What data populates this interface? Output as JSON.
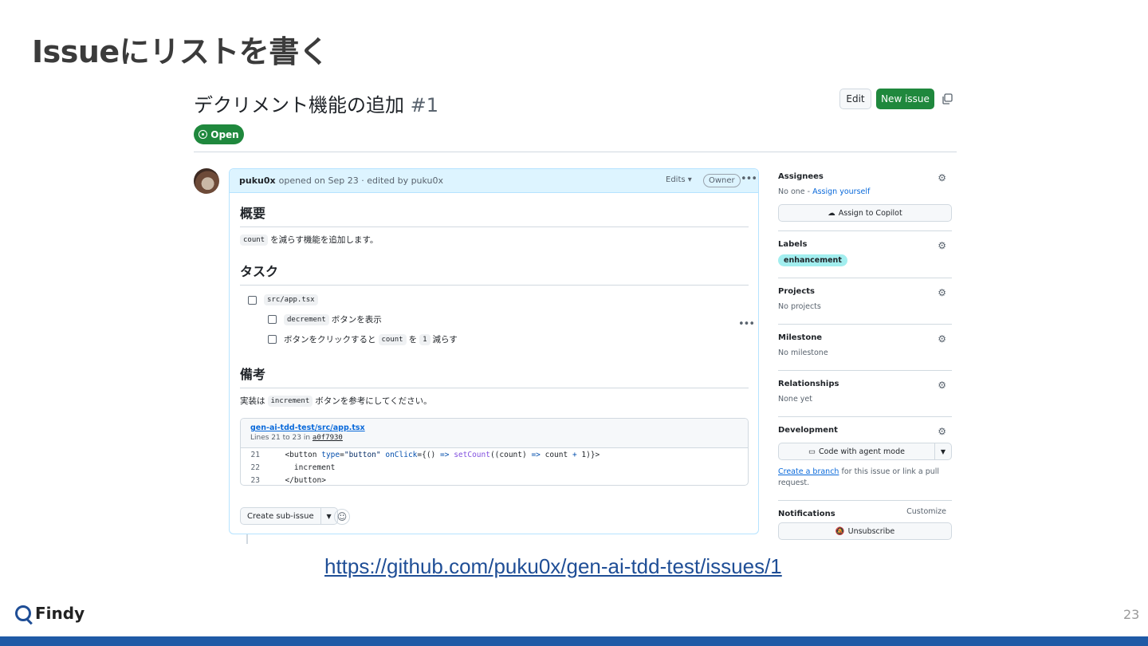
{
  "slide": {
    "title": "Issueにリストを書く",
    "url": "https://github.com/puku0x/gen-ai-tdd-test/issues/1",
    "logo_text": "Findy",
    "page_number": "23"
  },
  "issue": {
    "title": "デクリメント機能の追加",
    "number": "#1",
    "edit_label": "Edit",
    "new_issue_label": "New issue",
    "state": "Open"
  },
  "comment": {
    "author": "puku0x",
    "meta": "opened on Sep 23 · edited by puku0x",
    "edits_label": "Edits ▾",
    "owner_badge": "Owner",
    "sections": {
      "overview_heading": "概要",
      "overview_code": "count",
      "overview_text": "を減らす機能を追加します。",
      "tasks_heading": "タスク",
      "task1_code": "src/app.tsx",
      "task2_code": "decrement",
      "task2_text": "ボタンを表示",
      "task3_pre": "ボタンをクリックすると",
      "task3_code1": "count",
      "task3_mid": "を",
      "task3_code2": "1",
      "task3_post": "減らす",
      "notes_heading": "備考",
      "notes_pre": "実装は",
      "notes_code": "increment",
      "notes_post": "ボタンを参考にしてください。"
    },
    "permalink": {
      "file": "gen-ai-tdd-test/src/app.tsx",
      "lines_text": "Lines 21 to 23 in",
      "sha": "a0f7930",
      "rows": [
        {
          "ln": "21",
          "indent": "  ",
          "tag_open": "<button ",
          "attr1": "type",
          "eq1": "=",
          "str1": "\"button\"",
          "sp": " ",
          "attr2": "onClick",
          "eq2": "={() ",
          "arrow": "=>",
          "sp2": " ",
          "fn": "setCount",
          "args": "((count) ",
          "arrow2": "=>",
          "rest": " count ",
          "plus": "+",
          "tail": " 1)}>"
        },
        {
          "ln": "22",
          "text": "    increment"
        },
        {
          "ln": "23",
          "text": "  </button>"
        }
      ]
    },
    "create_sub_issue_label": "Create sub-issue"
  },
  "sidebar": {
    "assignees": {
      "title": "Assignees",
      "value": "No one - ",
      "link": "Assign yourself",
      "button": "Assign to Copilot"
    },
    "labels": {
      "title": "Labels",
      "label": "enhancement"
    },
    "projects": {
      "title": "Projects",
      "value": "No projects"
    },
    "milestone": {
      "title": "Milestone",
      "value": "No milestone"
    },
    "relationships": {
      "title": "Relationships",
      "value": "None yet"
    },
    "development": {
      "title": "Development",
      "button": "Code with agent mode",
      "link": "Create a branch",
      "text": "for this issue or link a pull request."
    },
    "notifications": {
      "title": "Notifications",
      "customize": "Customize",
      "button": "Unsubscribe"
    }
  },
  "colors": {
    "open_green": "#1f883d",
    "label_bg": "#a2eeef",
    "accent_blue": "#1f5aa6"
  }
}
